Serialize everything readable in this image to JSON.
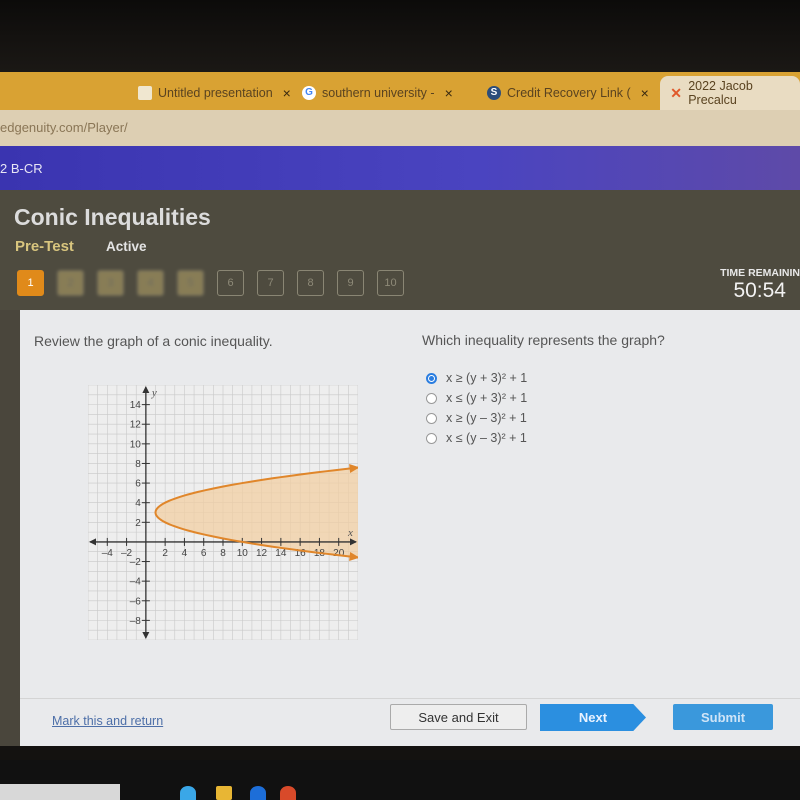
{
  "browser": {
    "tabs": [
      {
        "label": "Untitled presentation",
        "icon": "slides-icon",
        "close": "×"
      },
      {
        "label": "southern university -",
        "icon": "google-icon",
        "icon_glyph": "G",
        "close": "×"
      },
      {
        "label": "Credit Recovery Link (",
        "icon": "site-s-icon",
        "icon_glyph": "S",
        "close": "×"
      },
      {
        "label": "2022 Jacob Precalcu",
        "icon": "edgenuity-x-icon",
        "icon_glyph": "✕",
        "active": true
      }
    ],
    "url": "edgenuity.com/Player/"
  },
  "topnav": {
    "course": "2 B-CR"
  },
  "header": {
    "title": "Conic Inequalities",
    "subtitle": "Pre-Test",
    "status": "Active",
    "questions": [
      "1",
      "2",
      "3",
      "4",
      "5",
      "6",
      "7",
      "8",
      "9",
      "10"
    ],
    "current_question": 1,
    "time_label": "TIME REMAININ",
    "time_value": "50:54"
  },
  "question": {
    "left_prompt": "Review the graph of a conic inequality.",
    "right_prompt": "Which inequality represents the graph?",
    "options": [
      {
        "text": "x ≥ (y + 3)² + 1",
        "selected": true
      },
      {
        "text": "x ≤ (y + 3)² + 1",
        "selected": false
      },
      {
        "text": "x ≥ (y – 3)² + 1",
        "selected": false
      },
      {
        "text": "x ≤ (y – 3)² + 1",
        "selected": false
      }
    ]
  },
  "chart_data": {
    "type": "line",
    "title": "",
    "xlabel": "x",
    "ylabel": "y",
    "xlim": [
      -6,
      22
    ],
    "ylim": [
      -10,
      16
    ],
    "grid": true,
    "x_ticks": [
      -4,
      -2,
      2,
      4,
      6,
      8,
      10,
      12,
      14,
      16,
      18,
      20
    ],
    "y_ticks": [
      -8,
      -6,
      -4,
      -2,
      2,
      4,
      6,
      8,
      10,
      12,
      14
    ],
    "curve": {
      "equation": "x = (y - 3)^2 + 1",
      "vertex": [
        1,
        3
      ],
      "opens": "right",
      "y_range": [
        -1.6,
        7.6
      ],
      "style": "solid",
      "arrows": true
    },
    "shading": "inside (right of curve)",
    "colors": {
      "curve": "#e0862a",
      "fill": "#f2cfa3",
      "grid": "#c8c8c8",
      "axis": "#333333"
    }
  },
  "footer": {
    "mark_link": "Mark this and return",
    "save_exit": "Save and Exit",
    "next": "Next",
    "submit": "Submit"
  }
}
